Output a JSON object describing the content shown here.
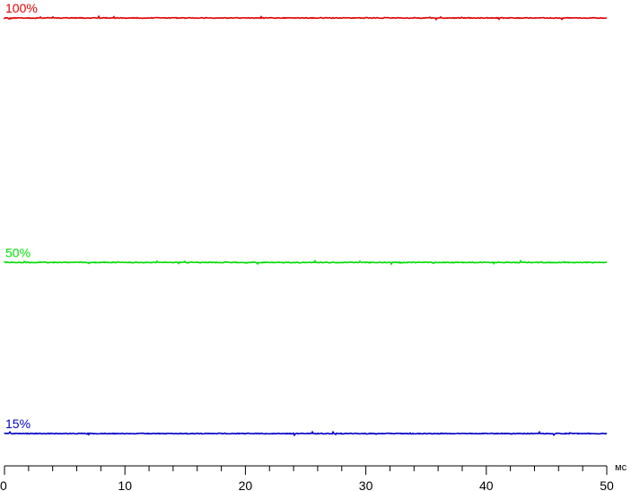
{
  "chart_data": {
    "type": "line",
    "title": "",
    "xlabel": "мс",
    "ylabel": "",
    "xlim": [
      0,
      50
    ],
    "x_major_ticks": [
      0,
      10,
      20,
      30,
      40,
      50
    ],
    "x_minor_step": 2,
    "ylim": [
      0,
      100
    ],
    "grid": false,
    "legend": "none",
    "series": [
      {
        "name": "100%",
        "color": "#e00000",
        "x": [
          0,
          50
        ],
        "y": [
          100,
          100
        ]
      },
      {
        "name": "50%",
        "color": "#00dd00",
        "x": [
          0,
          50
        ],
        "y": [
          50,
          50
        ]
      },
      {
        "name": "15%",
        "color": "#0000c8",
        "x": [
          0,
          50
        ],
        "y": [
          15,
          15
        ]
      }
    ]
  }
}
